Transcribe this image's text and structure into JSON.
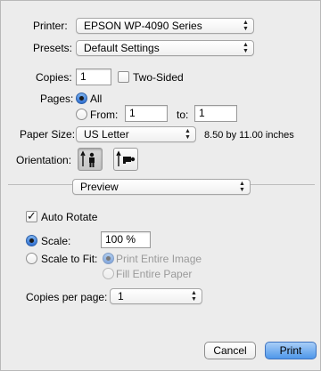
{
  "printer": {
    "label": "Printer:",
    "value": "EPSON WP-4090 Series"
  },
  "presets": {
    "label": "Presets:",
    "value": "Default Settings"
  },
  "copies": {
    "label": "Copies:",
    "value": "1",
    "two_sided_label": "Two-Sided",
    "two_sided_checked": false
  },
  "pages": {
    "label": "Pages:",
    "all_label": "All",
    "from_label": "From:",
    "from_value": "1",
    "to_label": "to:",
    "to_value": "1",
    "selected": "all"
  },
  "paper_size": {
    "label": "Paper Size:",
    "value": "US Letter",
    "dimensions": "8.50 by 11.00 inches"
  },
  "orientation": {
    "label": "Orientation:",
    "selected": "portrait"
  },
  "section_popup": {
    "value": "Preview"
  },
  "auto_rotate": {
    "label": "Auto Rotate",
    "checked": true
  },
  "scale": {
    "label": "Scale:",
    "value": "100 %",
    "selected": true
  },
  "scale_to_fit": {
    "label": "Scale to Fit:",
    "print_entire_image": "Print Entire Image",
    "fill_entire_paper": "Fill Entire Paper"
  },
  "copies_per_page": {
    "label": "Copies per page:",
    "value": "1"
  },
  "buttons": {
    "cancel": "Cancel",
    "print": "Print"
  },
  "colors": {
    "accent": "#4f97ea",
    "dialog_bg": "#ececec"
  },
  "icons": {
    "popup_arrows": "updown-arrows-icon",
    "portrait": "portrait-orientation-icon",
    "landscape": "landscape-orientation-icon"
  }
}
